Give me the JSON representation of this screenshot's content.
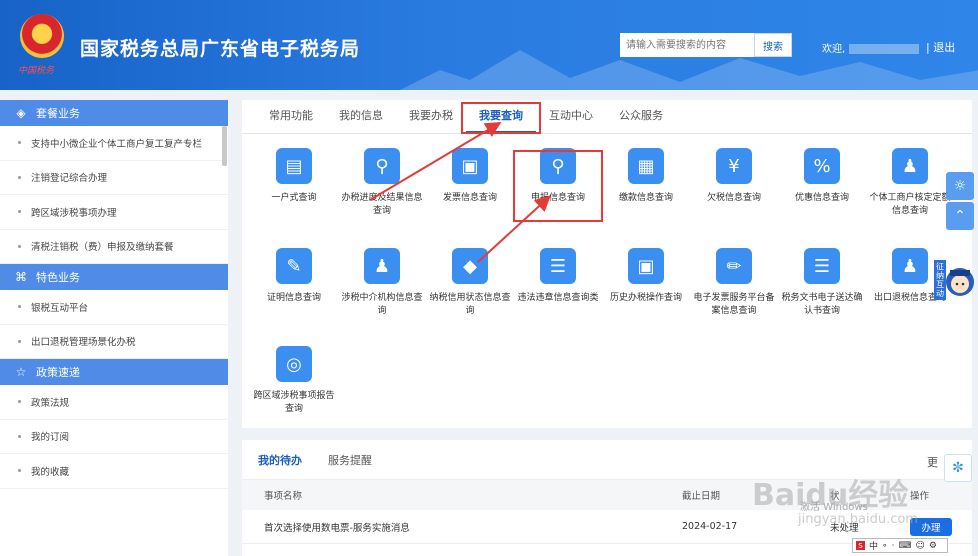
{
  "header": {
    "site_title": "国家税务总局广东省电子税务局",
    "emblem_caption": "中国税务",
    "search_placeholder": "请输入需要搜索的内容",
    "search_button": "搜索",
    "welcome": "欢迎,",
    "logout": "| 退出"
  },
  "sidebar": {
    "sections": [
      {
        "title": "套餐业务",
        "icon": "layers-icon"
      },
      {
        "title": "特色业务",
        "icon": "grid-icon"
      },
      {
        "title": "政策速递",
        "icon": "star-icon"
      }
    ],
    "items_a": [
      "支持中小微企业个体工商户复工复产专栏",
      "注销登记综合办理",
      "跨区域涉税事项办理",
      "清税注销税（费）申报及缴纳套餐"
    ],
    "items_b": [
      "银税互动平台",
      "出口退税管理场景化办税"
    ],
    "items_c": [
      "政策法规",
      "我的订阅",
      "我的收藏"
    ]
  },
  "tabs": [
    "常用功能",
    "我的信息",
    "我要办税",
    "我要查询",
    "互动中心",
    "公众服务"
  ],
  "active_tab": "我要查询",
  "services": [
    {
      "label": "一户式查询",
      "icon": "computer-search-icon",
      "color": "#3b8ff0"
    },
    {
      "label": "办税进度及结果信息查询",
      "icon": "magnifier-list-icon",
      "color": "#3b8ff0"
    },
    {
      "label": "发票信息查询",
      "icon": "ticket-search-icon",
      "color": "#3b8ff0"
    },
    {
      "label": "申报信息查询",
      "icon": "magnifier-list-icon",
      "color": "#3b8ff0"
    },
    {
      "label": "缴款信息查询",
      "icon": "card-search-icon",
      "color": "#3b8ff0"
    },
    {
      "label": "欠税信息查询",
      "icon": "yen-receipt-icon",
      "color": "#3b8ff0"
    },
    {
      "label": "优惠信息查询",
      "icon": "percent-tag-icon",
      "color": "#3b8ff0"
    },
    {
      "label": "个体工商户核定定额信息查询",
      "icon": "person-search-icon",
      "color": "#3b8ff0"
    },
    {
      "label": "证明信息查询",
      "icon": "document-search-icon",
      "color": "#3b8ff0"
    },
    {
      "label": "涉税中介机构信息查询",
      "icon": "person-icon",
      "color": "#3b8ff0"
    },
    {
      "label": "纳税信用状态信息查询",
      "icon": "diamond-search-icon",
      "color": "#3b8ff0"
    },
    {
      "label": "违法违章信息查询类",
      "icon": "list-document-icon",
      "color": "#3b8ff0"
    },
    {
      "label": "历史办税操作查询",
      "icon": "window-search-icon",
      "color": "#3b8ff0"
    },
    {
      "label": "电子发票服务平台备案信息查询",
      "icon": "pen-icon",
      "color": "#3b8ff0"
    },
    {
      "label": "税务文书电子送达确认书查询",
      "icon": "clipboard-icon",
      "color": "#3b8ff0"
    },
    {
      "label": "出口退税信息查询",
      "icon": "person-coin-icon",
      "color": "#3b8ff0"
    },
    {
      "label": "跨区域涉税事项报告查询",
      "icon": "target-icon",
      "color": "#3b8ff0"
    }
  ],
  "todo": {
    "tabs": [
      "我的待办",
      "服务提醒"
    ],
    "more": "更",
    "headers": [
      "事项名称",
      "截止日期",
      "状",
      "操作"
    ],
    "rows": [
      {
        "name": "首次选择使用数电票-服务实施消息",
        "date": "2024-02-17",
        "status": "未处理",
        "action": "办理"
      }
    ]
  },
  "float": {
    "mascot_text": "征纳互动"
  },
  "watermark": {
    "brand": "Baidu经验",
    "url": "jingyan.baidu.com",
    "activate": "激活 Windows"
  },
  "ime": [
    "中",
    "∘",
    "·",
    ",",
    "⌨",
    "☺",
    "⚙"
  ],
  "colors": {
    "brand": "#1b5fbf",
    "accent": "#3b8ff0",
    "annotation": "#e53a36"
  }
}
